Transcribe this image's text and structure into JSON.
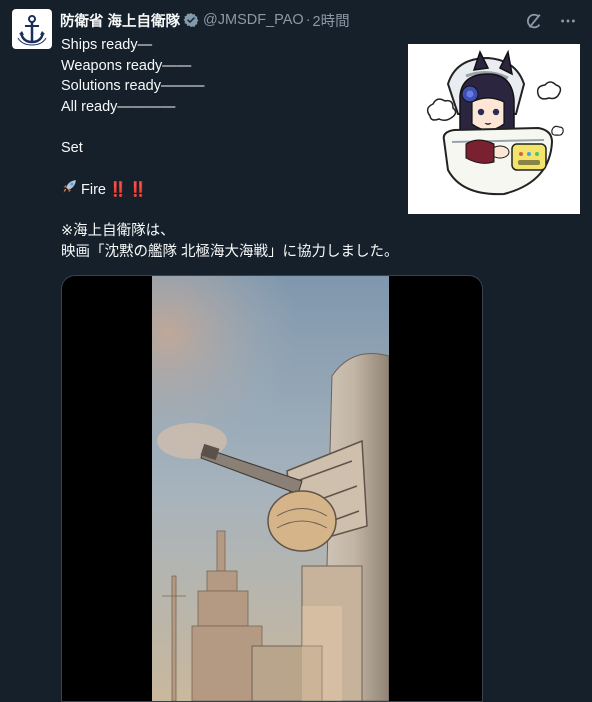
{
  "tweet": {
    "author_name": "防衛省 海上自衛隊",
    "handle": "@JMSDF_PAO",
    "separator": "·",
    "time": "2時間",
    "lines": [
      "Ships ready—",
      "Weapons ready——",
      "Solutions ready———",
      "All ready————",
      "",
      "Set",
      ""
    ],
    "fire_text": "Fire",
    "fire_marks": "‼️ ‼️",
    "note_line1": "※海上自衛隊は、",
    "note_line2": "映画「沈黙の艦隊 北極海大海戦」に協力しました。"
  },
  "icons": {
    "avatar": "anchor-emblem-icon",
    "verified": "verified-badge-icon",
    "grok": "grok-icon",
    "more": "more-icon",
    "rocket": "rocket-icon"
  },
  "colors": {
    "background": "#15202b",
    "text": "#f7f9f9",
    "secondary": "#8b98a5",
    "verified": "#829aab",
    "accent_red": "#e0245e"
  }
}
